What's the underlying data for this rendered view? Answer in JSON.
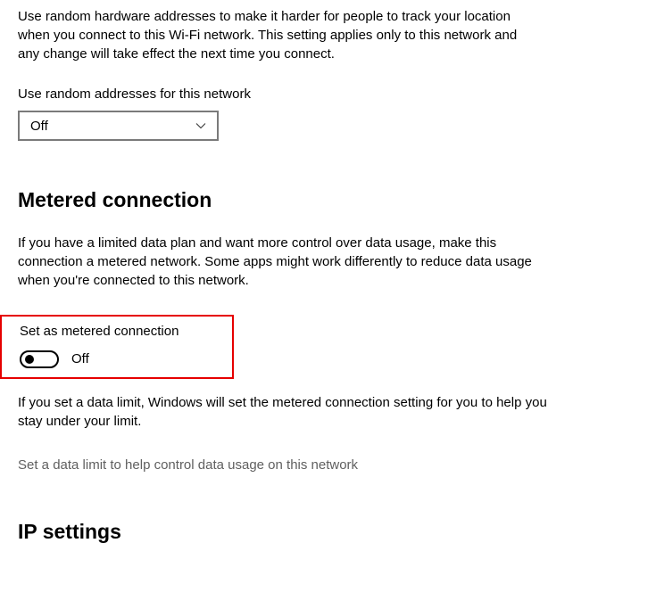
{
  "random_hw": {
    "description": "Use random hardware addresses to make it harder for people to track your location when you connect to this Wi-Fi network. This setting applies only to this network and any change will take effect the next time you connect.",
    "label": "Use random addresses for this network",
    "value": "Off"
  },
  "metered": {
    "heading": "Metered connection",
    "description": "If you have a limited data plan and want more control over data usage, make this connection a metered network. Some apps might work differently to reduce data usage when you're connected to this network.",
    "toggle_label": "Set as metered connection",
    "toggle_state": "Off",
    "data_limit_desc": "If you set a data limit, Windows will set the metered connection setting for you to help you stay under your limit.",
    "data_limit_link": "Set a data limit to help control data usage on this network"
  },
  "ip": {
    "heading": "IP settings"
  }
}
